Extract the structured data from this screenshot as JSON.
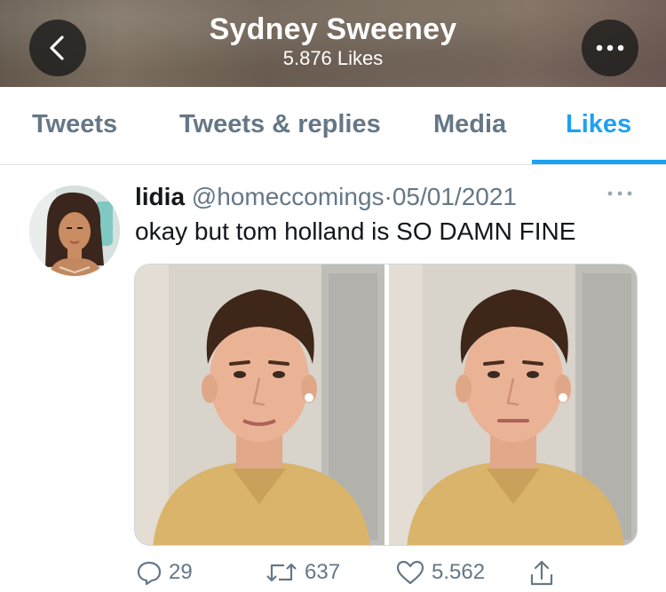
{
  "header": {
    "title": "Sydney Sweeney",
    "subtitle": "5.876 Likes"
  },
  "tabs": [
    {
      "label": "Tweets"
    },
    {
      "label": "Tweets & replies"
    },
    {
      "label": "Media"
    },
    {
      "label": "Likes",
      "active": true
    }
  ],
  "tweet": {
    "name": "lidia",
    "handle": "@homeccomings",
    "separator": "·",
    "date": "05/01/2021",
    "text": "okay but tom holland is SO DAMN FINE",
    "actions": {
      "replies": "29",
      "retweets": "637",
      "likes": "5.562"
    }
  },
  "icons": {
    "back": "chevron-left-icon",
    "more": "more-horizontal-icon",
    "reply": "speech-bubble-icon",
    "retweet": "retweet-icon",
    "like": "heart-icon",
    "share": "share-icon"
  },
  "colors": {
    "accent": "#1da1f2",
    "secondary_text": "#657786",
    "primary_text": "#14171a"
  }
}
